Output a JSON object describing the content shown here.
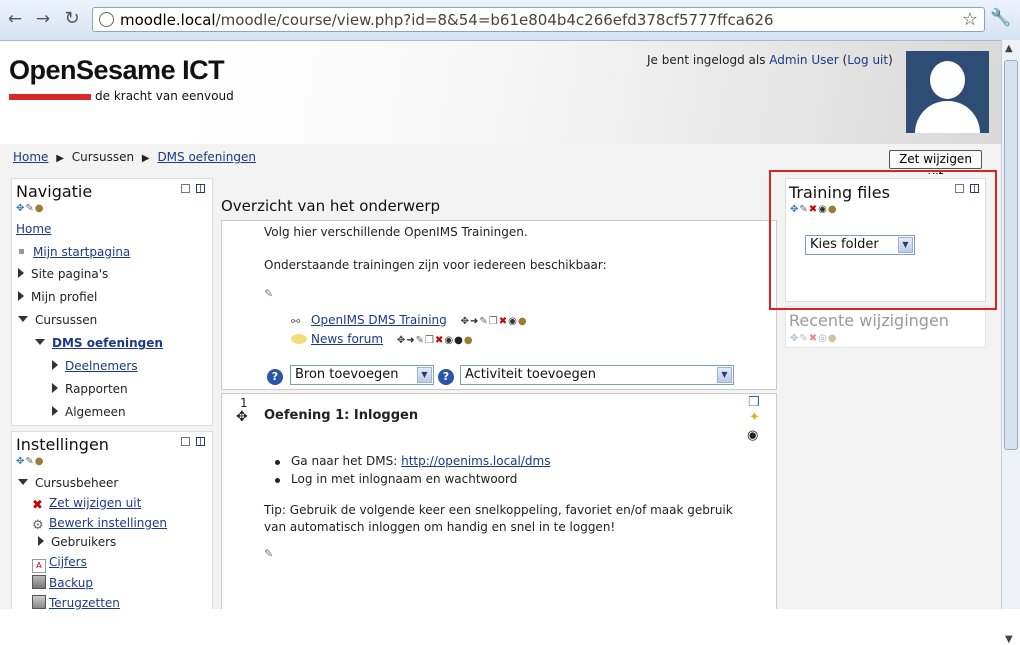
{
  "browser": {
    "url_prefix": "moodle.local",
    "url_rest": "/moodle/course/view.php?id=8&54=b61e804b4c266efd378cf5777ffca626"
  },
  "header": {
    "site_title": "OpenSesame ICT",
    "tagline": "de kracht van eenvoud",
    "login_prefix": "Je bent ingelogd als ",
    "user_name": "Admin User",
    "logout_link": "Log uit",
    "login_open": " (",
    "login_close": ")"
  },
  "breadcrumb": {
    "home": "Home",
    "sep": "▶",
    "courses": "Cursussen",
    "course": "DMS oefeningen"
  },
  "edit_button": "Zet wijzigen uit",
  "navigation": {
    "title": "Navigatie",
    "home": "Home",
    "my_home": "Mijn startpagina",
    "site_pages": "Site pagina's",
    "my_profile": "Mijn profiel",
    "courses": "Cursussen",
    "course": "DMS oefeningen",
    "participants": "Deelnemers",
    "reports": "Rapporten",
    "general": "Algemeen"
  },
  "settings": {
    "title": "Instellingen",
    "course_admin": "Cursusbeheer",
    "edit_off": "Zet wijzigen uit",
    "edit_settings": "Bewerk instellingen",
    "users": "Gebruikers",
    "grades": "Cijfers",
    "backup": "Backup",
    "restore": "Terugzetten"
  },
  "main": {
    "title": "Overzicht van het onderwerp",
    "intro1": "Volg hier verschillende OpenIMS Trainingen.",
    "intro2": "Onderstaande trainingen zijn voor iedereen beschikbaar:",
    "activities": [
      {
        "label": "OpenIMS DMS Training"
      },
      {
        "label": "News forum"
      }
    ],
    "add_resource": "Bron toevoegen",
    "add_activity": "Activiteit toevoegen",
    "section_number": "1",
    "exercise_title": "Oefening 1: Inloggen",
    "step1_prefix": "Ga naar het DMS: ",
    "step1_link": "http://openims.local/dms",
    "step2": "Log in met inlognaam en wachtwoord",
    "tip": "Tip: Gebruik de volgende keer een snelkoppeling, favoriet en/of maak gebruik van automatisch inloggen om handig en snel in te loggen!"
  },
  "training_files": {
    "title": "Training files",
    "select_value": "Kies folder"
  },
  "recent": {
    "title": "Recente wijzigingen"
  },
  "colors": {
    "highlight": "#d9231c",
    "link": "#1d3a8a",
    "logo_bar": "#d62a2a"
  }
}
